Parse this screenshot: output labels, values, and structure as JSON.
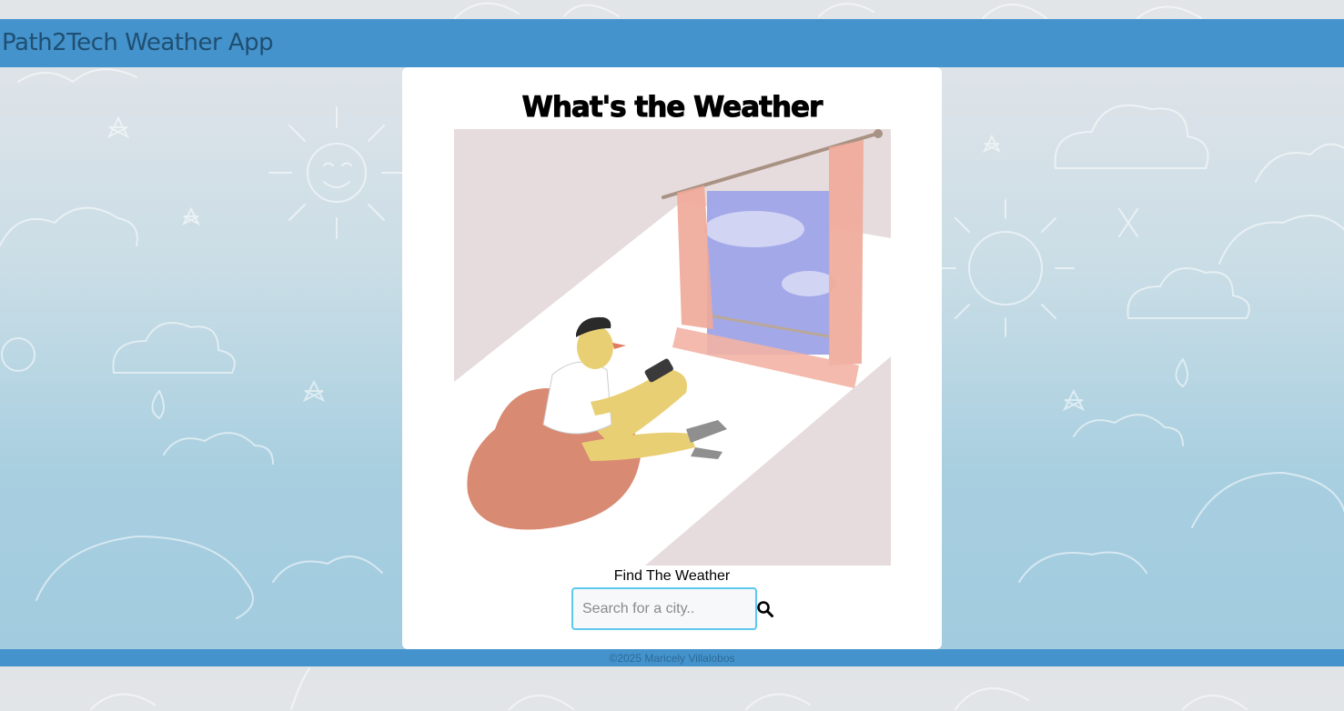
{
  "navbar": {
    "brand": "Path2Tech Weather App"
  },
  "card": {
    "heading": "What's the Weather",
    "illustration_icon": "person-looking-out-window-illustration"
  },
  "search": {
    "label": "Find The Weather",
    "placeholder": "Search for a city..",
    "value": "",
    "button_icon": "search-icon"
  },
  "footer": {
    "text": "©2025 Maricely Villalobos"
  },
  "colors": {
    "navbar": "#4493cc",
    "input_border": "#5ec7ee",
    "card_bg": "#ffffff"
  }
}
